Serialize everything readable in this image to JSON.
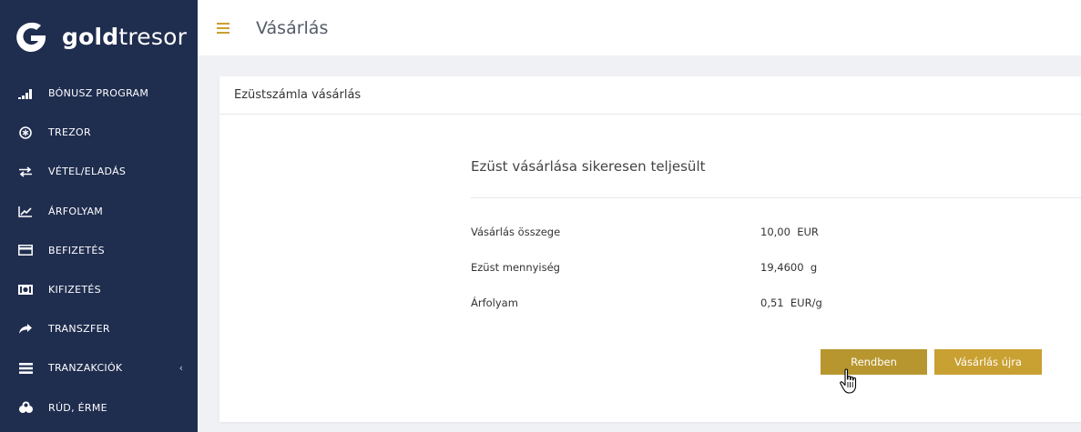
{
  "brand": {
    "name_bold": "gold",
    "name_light": "tresor"
  },
  "sidebar": {
    "items": [
      {
        "icon": "signal-bars-icon",
        "label": "BÓNUSZ PROGRAM"
      },
      {
        "icon": "asterisk-circle-icon",
        "label": "TREZOR"
      },
      {
        "icon": "arrows-exchange-icon",
        "label": "VÉTEL/ELADÁS"
      },
      {
        "icon": "line-chart-icon",
        "label": "ÁRFOLYAM"
      },
      {
        "icon": "credit-card-icon",
        "label": "BEFIZETÉS"
      },
      {
        "icon": "banknote-icon",
        "label": "KIFIZETÉS"
      },
      {
        "icon": "share-arrow-icon",
        "label": "TRANSZFER"
      },
      {
        "icon": "list-icon",
        "label": "TRANZAKCIÓK",
        "chevron": "‹"
      },
      {
        "icon": "coins-icon",
        "label": "RÚD, ÉRME"
      }
    ]
  },
  "header": {
    "title": "Vásárlás"
  },
  "card": {
    "title": "Ezüstszámla vásárlás",
    "success": "Ezüst vásárlása sikeresen teljesült",
    "rows": [
      {
        "label": "Vásárlás összege",
        "value": "10,00  EUR"
      },
      {
        "label": "Ezüst mennyiség",
        "value": "19,4600  g"
      },
      {
        "label": "Árfolyam",
        "value": "0,51  EUR/g"
      }
    ],
    "ok_button": "Rendben",
    "again_button": "Vásárlás újra"
  },
  "colors": {
    "sidebar": "#1f2d4f",
    "accent": "#c9a032",
    "accent_dark": "#b8962f"
  }
}
